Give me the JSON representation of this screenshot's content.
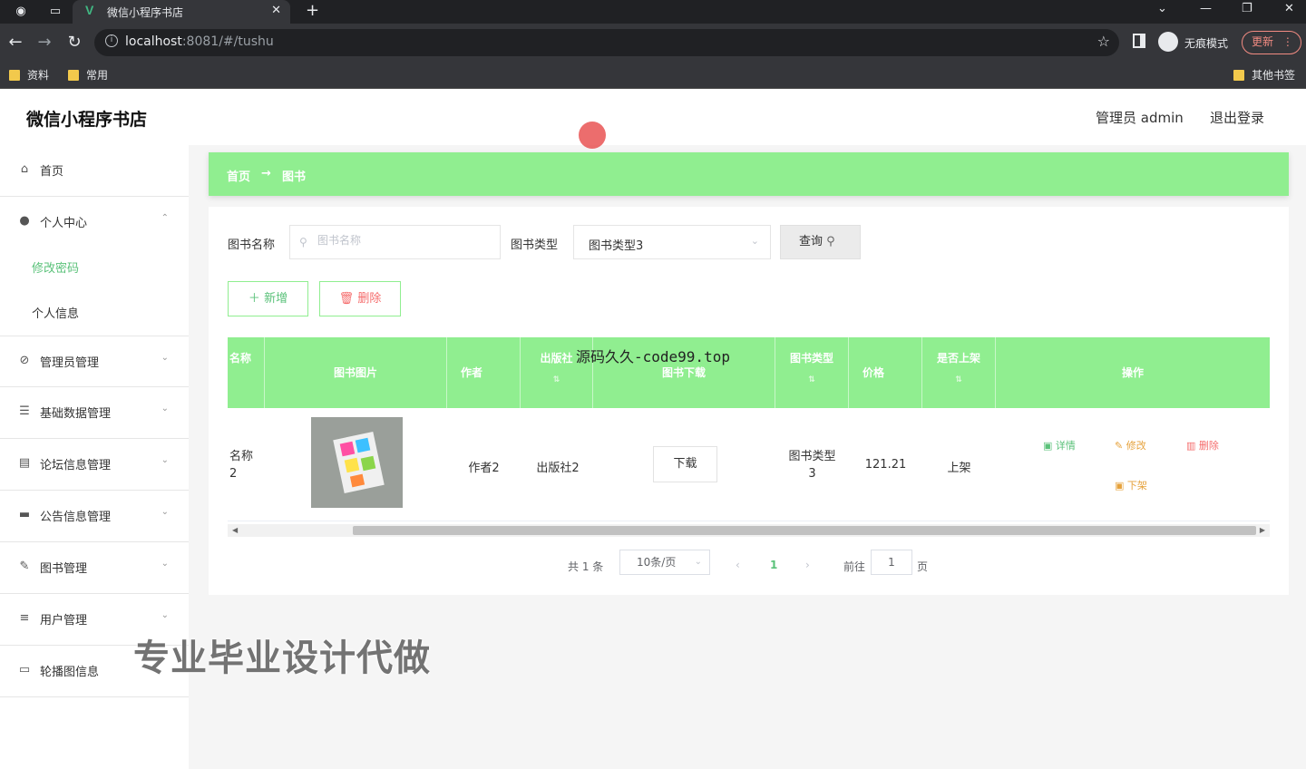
{
  "browser": {
    "tab_title": "微信小程序书店",
    "tab_favicon": "V",
    "url_host": "localhost",
    "url_rest": ":8081/#/tushu",
    "incognito_label": "无痕模式",
    "update_label": "更新",
    "bookmarks": [
      "资料",
      "常用"
    ],
    "other_bookmarks": "其他书签"
  },
  "header": {
    "brand": "微信小程序书店",
    "admin_label": "管理员 admin",
    "logout": "退出登录"
  },
  "sidebar": {
    "home": "首页",
    "personal_center": "个人中心",
    "sub_items": [
      "修改密码",
      "个人信息"
    ],
    "items": [
      "管理员管理",
      "基础数据管理",
      "论坛信息管理",
      "公告信息管理",
      "图书管理",
      "用户管理",
      "轮播图信息"
    ]
  },
  "breadcrumb": {
    "home": "首页",
    "arrow": "→",
    "current": "图书"
  },
  "search": {
    "name_label": "图书名称",
    "name_placeholder": "图书名称",
    "type_label": "图书类型",
    "type_value": "图书类型3",
    "query_button": "查询"
  },
  "actions": {
    "add": "新增",
    "delete": "删除"
  },
  "table": {
    "headers": [
      "名称",
      "图书图片",
      "作者",
      "出版社",
      "图书下载",
      "图书类型",
      "价格",
      "是否上架",
      "操作"
    ],
    "rows": [
      {
        "name_line1": "名称",
        "name_line2": "2",
        "author": "作者2",
        "publisher": "出版社2",
        "download": "下载",
        "type_line1": "图书类型",
        "type_line2": "3",
        "price": "121.21",
        "listed": "上架",
        "op_detail": "详情",
        "op_edit": "修改",
        "op_delete": "删除",
        "op_unlist": "下架"
      }
    ]
  },
  "pagination": {
    "total": "共 1 条",
    "page_size": "10条/页",
    "current_page": "1",
    "goto_label": "前往",
    "goto_value": "1",
    "page_unit": "页"
  },
  "overlays": {
    "source_watermark": "源码久久-code99.top",
    "promo": "专业毕业设计代做"
  },
  "colors": {
    "accent_green": "#90ee90",
    "active_text": "#5bc27a",
    "danger": "#f56c6c",
    "warning": "#e6a23c"
  }
}
